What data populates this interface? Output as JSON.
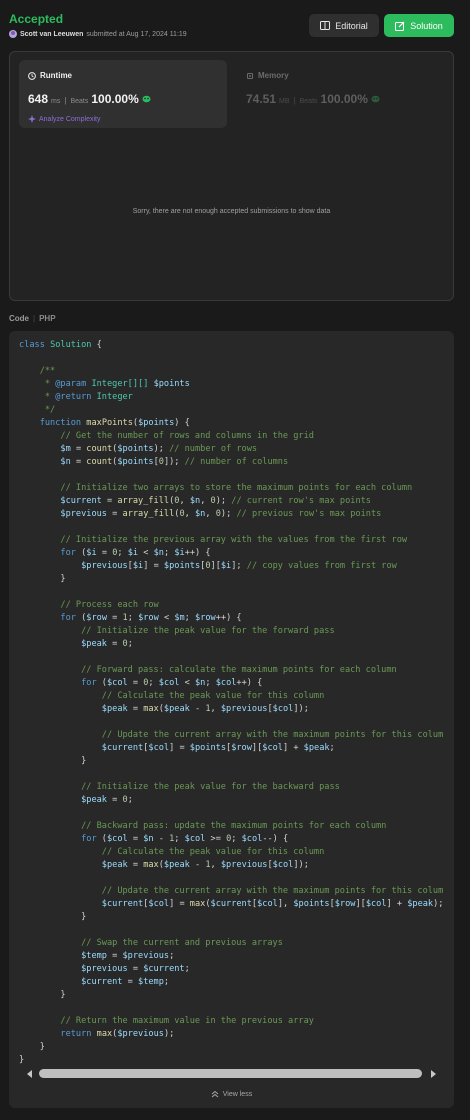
{
  "header": {
    "status": "Accepted",
    "submitter_name": "Scott van Leeuwen",
    "submitted_text": "submitted at Aug 17, 2024 11:19",
    "editorial_label": "Editorial",
    "solution_label": "Solution"
  },
  "performance": {
    "runtime": {
      "label": "Runtime",
      "value": "648",
      "unit": "ms",
      "separator": "|",
      "beats_label": "Beats",
      "beats_pct": "100.00%"
    },
    "memory": {
      "label": "Memory",
      "value": "74.51",
      "unit": "MB",
      "separator": "|",
      "beats_label": "Beats",
      "beats_pct": "100.00%"
    },
    "analyze_label": "Analyze Complexity",
    "empty_message": "Sorry, there are not enough accepted submissions to show data"
  },
  "code_section": {
    "label": "Code",
    "separator": "|",
    "language": "PHP",
    "view_less_label": "View less",
    "lines": [
      "class Solution {",
      "",
      "    /**",
      "     * @param Integer[][] $points",
      "     * @return Integer",
      "     */",
      "    function maxPoints($points) {",
      "        // Get the number of rows and columns in the grid",
      "        $m = count($points); // number of rows",
      "        $n = count($points[0]); // number of columns",
      "",
      "        // Initialize two arrays to store the maximum points for each column",
      "        $current = array_fill(0, $n, 0); // current row's max points",
      "        $previous = array_fill(0, $n, 0); // previous row's max points",
      "",
      "        // Initialize the previous array with the values from the first row",
      "        for ($i = 0; $i < $n; $i++) {",
      "            $previous[$i] = $points[0][$i]; // copy values from first row",
      "        }",
      "",
      "        // Process each row",
      "        for ($row = 1; $row < $m; $row++) {",
      "            // Initialize the peak value for the forward pass",
      "            $peak = 0;",
      "",
      "            // Forward pass: calculate the maximum points for each column",
      "            for ($col = 0; $col < $n; $col++) {",
      "                // Calculate the peak value for this column",
      "                $peak = max($peak - 1, $previous[$col]);",
      "",
      "                // Update the current array with the maximum points for this column",
      "                $current[$col] = $points[$row][$col] + $peak;",
      "            }",
      "",
      "            // Initialize the peak value for the backward pass",
      "            $peak = 0;",
      "",
      "            // Backward pass: update the maximum points for each column",
      "            for ($col = $n - 1; $col >= 0; $col--) {",
      "                // Calculate the peak value for this column",
      "                $peak = max($peak - 1, $previous[$col]);",
      "",
      "                // Update the current array with the maximum points for this column",
      "                $current[$col] = max($current[$col], $points[$row][$col] + $peak);",
      "            }",
      "",
      "            // Swap the current and previous arrays",
      "            $temp = $previous;",
      "            $previous = $current;",
      "            $current = $temp;",
      "        }",
      "",
      "        // Return the maximum value in the previous array",
      "        return max($previous);",
      "    }",
      "}"
    ]
  },
  "colors": {
    "accepted": "#2cbb5d",
    "solution_button": "#2cbb5d",
    "analyze_purple": "#8a6fd9",
    "background": "#1a1a1a",
    "code_background": "#282828"
  },
  "icons": {
    "editorial": "book-icon",
    "solution": "edit-icon",
    "runtime": "clock-icon",
    "memory": "chip-icon",
    "beats": "leaf-icon",
    "analyze": "sparkle-icon",
    "view_less": "chevrons-up-icon",
    "scroll_left": "arrow-left-icon",
    "scroll_right": "arrow-right-icon"
  }
}
